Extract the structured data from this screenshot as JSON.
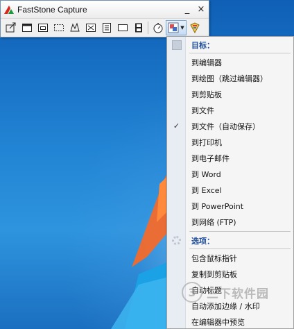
{
  "window": {
    "title": "FastStone Capture",
    "minimize_label": "_",
    "close_label": "×"
  },
  "toolbar": {
    "buttons": [
      {
        "icon": "capture-active-window-icon"
      },
      {
        "icon": "capture-window-object-icon"
      },
      {
        "icon": "capture-rectangular-region-icon"
      },
      {
        "icon": "capture-freehand-region-icon"
      },
      {
        "icon": "capture-fullscreen-icon"
      },
      {
        "icon": "capture-scrolling-window-icon"
      },
      {
        "icon": "capture-fixed-region-icon"
      },
      {
        "icon": "screen-recorder-icon"
      },
      {
        "icon": "delay-timer-icon"
      },
      {
        "icon": "output-destination-icon"
      },
      {
        "icon": "settings-icon"
      }
    ]
  },
  "menu": {
    "destination_header": "目标：",
    "destinations": [
      "到编辑器",
      "到绘图（跳过编辑器）",
      "到剪贴板",
      "到文件",
      "到文件（自动保存）",
      "到打印机",
      "到电子邮件",
      "到 Word",
      "到 Excel",
      "到 PowerPoint",
      "到网络 (FTP)"
    ],
    "checked_item": "到文件（自动保存）",
    "check_mark": "✓",
    "options_header": "选项：",
    "options": [
      "包含鼠标指针",
      "复制到剪贴板",
      "自动标题",
      "自动添加边缘 / 水印",
      "在编辑器中预览"
    ]
  },
  "watermark": {
    "logo_char": "3",
    "text": "三下软件园"
  },
  "colors": {
    "accent": "#1f4e9c",
    "wallpaper_blue": "#1d78c8",
    "flag_orange": "#f26a2a"
  }
}
